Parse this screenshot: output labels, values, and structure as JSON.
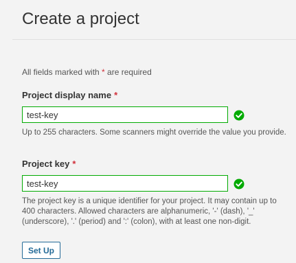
{
  "header": {
    "title": "Create a project"
  },
  "form": {
    "required_note_prefix": "All fields marked with ",
    "required_star": "*",
    "required_note_suffix": " are required",
    "display_name": {
      "label": "Project display name",
      "star": "*",
      "value": "test-key",
      "help": "Up to 255 characters. Some scanners might override the value you provide.",
      "status_icon": "check-circle-icon"
    },
    "project_key": {
      "label": "Project key",
      "star": "*",
      "value": "test-key",
      "help": "The project key is a unique identifier for your project. It may contain up to 400 characters. Allowed characters are alphanumeric, '-' (dash), '_' (underscore), '.' (period) and ':' (colon), with at least one non-digit.",
      "status_icon": "check-circle-icon"
    },
    "submit_label": "Set Up"
  },
  "colors": {
    "valid": "#00aa00",
    "required": "#d02f3a",
    "button": "#236a97",
    "background": "#f3f3f3"
  }
}
